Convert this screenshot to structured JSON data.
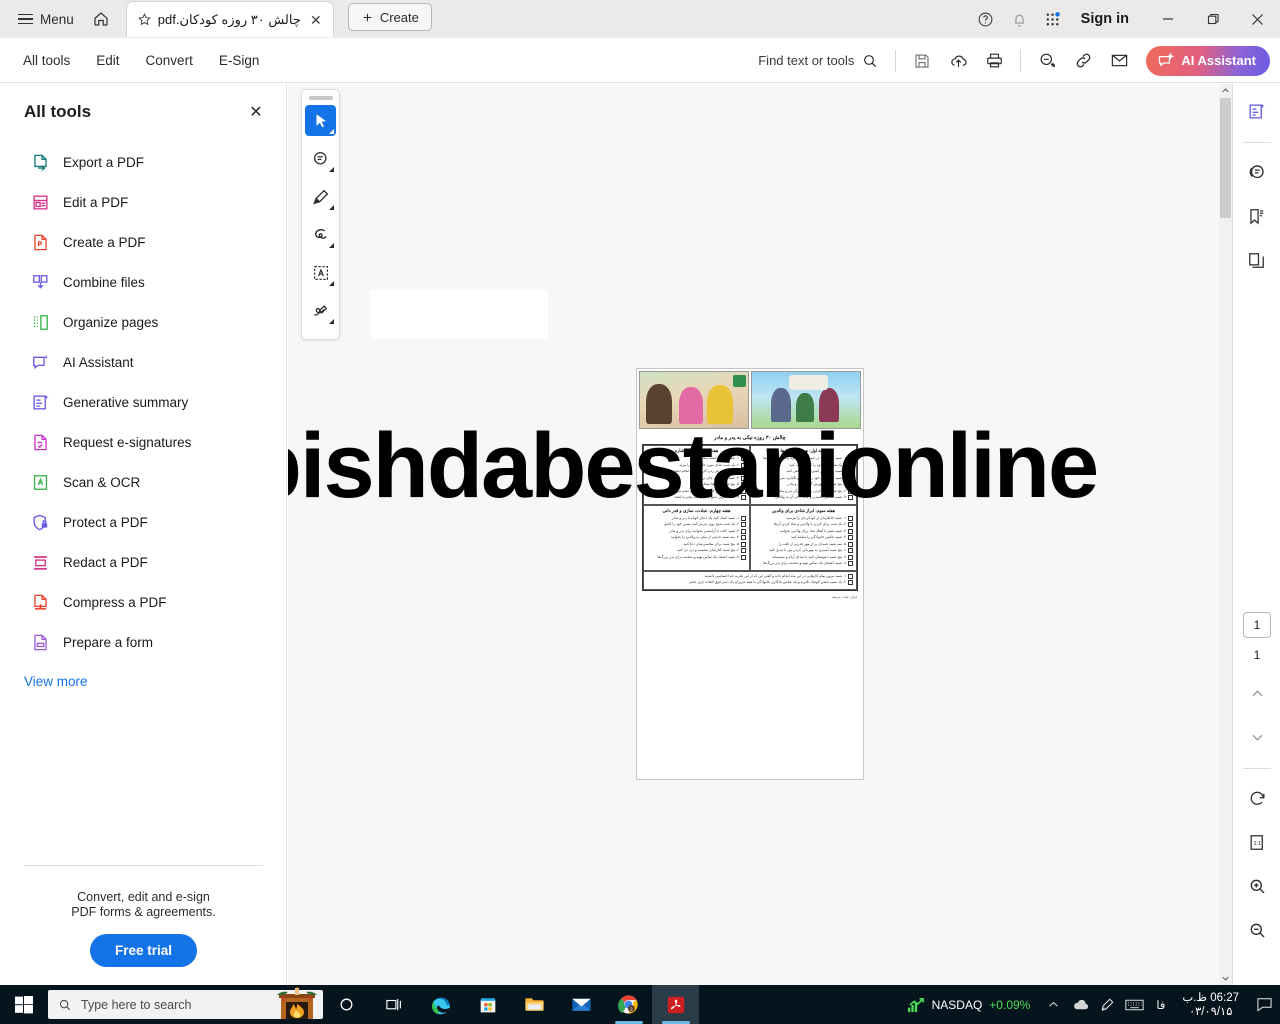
{
  "titlebar": {
    "menu_label": "Menu",
    "home_icon": "home-icon",
    "star_icon": "star-icon",
    "tab_title": "چالش ۳۰ روزه کودکان.pdf",
    "close_tab_icon": "close-icon",
    "create_label": "Create",
    "help_icon": "help-circle-icon",
    "bell_icon": "bell-icon",
    "apps_icon": "app-grid-icon",
    "signin_label": "Sign in",
    "minimize_icon": "minimize-icon",
    "restore_icon": "restore-icon",
    "close_icon": "close-icon"
  },
  "menubar": {
    "items": [
      {
        "label": "All tools"
      },
      {
        "label": "Edit"
      },
      {
        "label": "Convert"
      },
      {
        "label": "E-Sign"
      }
    ],
    "find_label": "Find text or tools",
    "find_icon": "search-icon",
    "save_icon": "save-icon",
    "upload_icon": "cloud-upload-icon",
    "print_icon": "print-icon",
    "stamp_icon": "add-stamp-icon",
    "link_icon": "link-icon",
    "mail_icon": "envelope-icon",
    "ai_label": "AI Assistant",
    "ai_icon": "ai-assistant-icon",
    "ai_gradient_from": "#ef6b5a",
    "ai_gradient_to": "#6a5ce4"
  },
  "sidebar": {
    "title": "All tools",
    "close_icon": "close-icon",
    "tools": [
      {
        "label": "Export a PDF",
        "icon": "export-pdf-icon",
        "color": "#147a7a"
      },
      {
        "label": "Edit a PDF",
        "icon": "edit-pdf-icon",
        "color": "#d63384"
      },
      {
        "label": "Create a PDF",
        "icon": "create-pdf-icon",
        "color": "#e8442e"
      },
      {
        "label": "Combine files",
        "icon": "combine-files-icon",
        "color": "#6a5ce4"
      },
      {
        "label": "Organize pages",
        "icon": "organize-pages-icon",
        "color": "#3ab54a"
      },
      {
        "label": "AI Assistant",
        "icon": "ai-assistant-icon",
        "color": "#6a5ce4"
      },
      {
        "label": "Generative summary",
        "icon": "generative-summary-icon",
        "color": "#6a5ce4"
      },
      {
        "label": "Request e-signatures",
        "icon": "request-signature-icon",
        "color": "#cc33cc"
      },
      {
        "label": "Scan & OCR",
        "icon": "scan-ocr-icon",
        "color": "#3ab54a"
      },
      {
        "label": "Protect a PDF",
        "icon": "protect-pdf-icon",
        "color": "#6a5ce4"
      },
      {
        "label": "Redact a PDF",
        "icon": "redact-pdf-icon",
        "color": "#d63384"
      },
      {
        "label": "Compress a PDF",
        "icon": "compress-pdf-icon",
        "color": "#e8442e"
      },
      {
        "label": "Prepare a form",
        "icon": "prepare-form-icon",
        "color": "#9b5cd6"
      }
    ],
    "view_more": "View more",
    "promo_line1": "Convert, edit and e-sign",
    "promo_line2": "PDF forms & agreements.",
    "free_trial": "Free trial",
    "accent_color": "#1473e6"
  },
  "annotation_toolbar": {
    "tools": [
      {
        "name": "select-tool",
        "icon": "cursor-arrow-icon",
        "active": true
      },
      {
        "name": "comment-tool",
        "icon": "comment-icon",
        "active": false
      },
      {
        "name": "highlight-tool",
        "icon": "highlighter-icon",
        "active": false
      },
      {
        "name": "draw-tool",
        "icon": "freehand-icon",
        "active": false
      },
      {
        "name": "text-select-tool",
        "icon": "select-text-icon",
        "active": false
      },
      {
        "name": "sign-tool",
        "icon": "sign-icon",
        "active": false
      }
    ],
    "active_color": "#1473e6"
  },
  "document": {
    "watermark": "@pishdabestanionline",
    "title": "چالش ۳۰ روزه نیکی به پدر و مادر",
    "footer": "قرآن: حیات عریضه",
    "photo_left": "family-kitchen-illustration",
    "photo_right": "family-house-illustration",
    "sections": [
      {
        "heading": "هفته اول: همیاری با کارها",
        "items": [
          "۱. شبید کمک کنید در جمع کردن سفره یا شستن ظرف‌ها",
          "۲. یک شب اتاق خود را کاملاً مرتب کنید",
          "۳. شبید با مادر در آشپزخانه همراهی کنید",
          "۴. شبید لباس‌های خود را تا کنید و بگذارید سر جایش",
          "۵. پنج شبید در آموزش گرفتن پدر و مادر",
          "۶. پنج شبید صبح کردن با یک بیدارگر پدر و مادر",
          "۷. شبید نقاشی کشیدن و هدیه دادن آن به والدین"
        ]
      },
      {
        "heading": "هفته اول: رفتار یا اشاره",
        "items": [
          "۱. شبید صبح با لبخند سلام کنید",
          "۲. یک شب غذای مورد علاقه‌شان را بپزید",
          "۳. شبید بدون غر زدن کار بخواهید انجام دهید",
          "۴. شبید برای‌شان چای بریزید",
          "۵. پنج شبید از آن‌ها تشکر کنید",
          "۶. پنج شبید صبر کنید تا حرف‌شان تمام شود",
          "۷. شبید آخرین صبح بخیر و شب بخیر با لبخند"
        ]
      },
      {
        "heading": "هفته سوم: ابراز شادی برای والدین",
        "items": [
          "۱. شبید خاطره‌ای از کودکی‌تان را بپرسید",
          "۲. یک شب برای کردن با والدین و شاد کردن آن‌ها",
          "۳. شبید شعر یا آهنگ شاد برای والدین بخوانید",
          "۴. شبید عکس خانوادگی را تماشا کنید",
          "۵. سه شبید نامه‌ای پر از مهر قدرتی از قلب را",
          "۶. پنج شبید آشپزی به مهربانی کردن بین با تبدیل کنید",
          "۷. پنج شبید دعوتشان کنید با صدای آرام و صمیمانه",
          "۸. شبید اعضای یک تماس تهیه و صحبت برای پدر بزرگ‌ها"
        ]
      },
      {
        "heading": "هفته چهارم: عبادت، سازی و قدر دانی",
        "items": [
          "۱. شبید کمک کنید یک دعای کوتاه با پدر و مادر",
          "۲. یک شب صبح روی پدرش کنید بستن خود را کامل",
          "۳. شبید کتاب با آرامشی بخوانید برای پدر و مادر",
          "۴. سه شبید حدیثی از نیکی به والدین را بخوانید",
          "۵. پنج شبید برای سلامتی‌شان دعا کنید",
          "۶. پنج شبید کنارشان بنشینید و درد دل کنید",
          "۷. شبید اعتماد یک تماس تهیه و صحبت برای پدر بزرگ‌ها"
        ]
      },
      {
        "heading": "",
        "items": [
          "۱. شبید مرور تمام کارهایی در این ماه انجام داده و گفتن این که از این تجربه چه احساسی داشتید",
          "۲. یک شبید جشن کوچک بگیرید و یک عکس یادگاری خانوادگی با همه عزیزان یک دسر فوق العاده بازی عصر"
        ]
      }
    ]
  },
  "right_rail": {
    "buttons": [
      {
        "name": "generative-summary-rail",
        "icon": "generative-summary-icon"
      },
      {
        "name": "comments-rail",
        "icon": "comment-icon"
      },
      {
        "name": "bookmarks-rail",
        "icon": "bookmark-icon"
      },
      {
        "name": "page-thumbnails-rail",
        "icon": "pages-icon"
      }
    ],
    "page_current": "1",
    "page_total": "1",
    "prev_icon": "chevron-up-icon",
    "next_icon": "chevron-down-icon",
    "rotate_icon": "rotate-icon",
    "fit_icon": "fit-page-icon",
    "zoom_in_icon": "zoom-in-icon",
    "zoom_out_icon": "zoom-out-icon"
  },
  "taskbar": {
    "start_icon": "windows-start-icon",
    "search_placeholder": "Type here to search",
    "search_icon": "search-icon",
    "fireplace_icon": "fireplace-icon",
    "cortana_icon": "cortana-circle-icon",
    "taskview_icon": "task-view-icon",
    "apps": [
      {
        "name": "edge-icon"
      },
      {
        "name": "microsoft-store-icon"
      },
      {
        "name": "file-explorer-icon"
      },
      {
        "name": "mail-icon"
      },
      {
        "name": "chrome-icon"
      },
      {
        "name": "acrobat-reader-icon"
      }
    ],
    "stock_name": "NASDAQ",
    "stock_change": "+0.09%",
    "stock_color": "#4ade5a",
    "tray_chevron": "chevron-up-icon",
    "tray_cloud": "onedrive-icon",
    "tray_pen": "pen-icon",
    "tray_keyboard": "keyboard-icon",
    "tray_lang": "فا",
    "clock_time": "06:27 ظ.ب",
    "clock_date": "۰۳/۰۹/۱۵",
    "notif_icon": "action-center-icon"
  }
}
